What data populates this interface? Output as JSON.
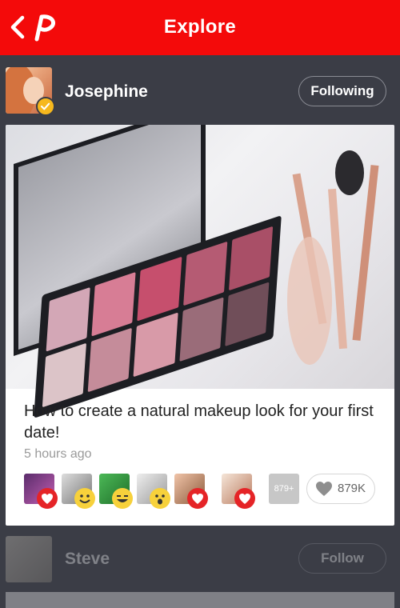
{
  "header": {
    "title": "Explore",
    "back_icon": "chevron-left-icon",
    "logo_icon": "pinterest-p-icon"
  },
  "post": {
    "author": {
      "name": "Josephine",
      "follow_label": "Following",
      "verified_icon": "verified-check-icon"
    },
    "caption": "How to create a natural makeup look for your first date!",
    "time": "5 hours ago",
    "more_count": "879+",
    "likes": "879K",
    "accent": "#f40a0a"
  },
  "next_post": {
    "author": {
      "name": "Steve",
      "follow_label": "Follow"
    }
  }
}
